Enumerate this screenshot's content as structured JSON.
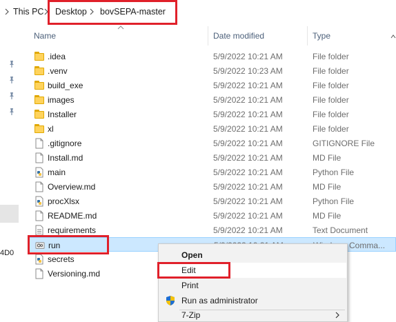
{
  "breadcrumb": {
    "items": [
      "This PC",
      "Desktop",
      "bovSEPA-master"
    ]
  },
  "leftnav": {
    "partial_label": "4D0"
  },
  "columns": {
    "name": "Name",
    "date_modified": "Date modified",
    "type": "Type"
  },
  "files": [
    {
      "name": ".idea",
      "date": "5/9/2022 10:21 AM",
      "type": "File folder",
      "icon": "folder-icon"
    },
    {
      "name": ".venv",
      "date": "5/9/2022 10:23 AM",
      "type": "File folder",
      "icon": "folder-icon"
    },
    {
      "name": "build_exe",
      "date": "5/9/2022 10:21 AM",
      "type": "File folder",
      "icon": "folder-icon"
    },
    {
      "name": "images",
      "date": "5/9/2022 10:21 AM",
      "type": "File folder",
      "icon": "folder-icon"
    },
    {
      "name": "Installer",
      "date": "5/9/2022 10:21 AM",
      "type": "File folder",
      "icon": "folder-icon"
    },
    {
      "name": "xl",
      "date": "5/9/2022 10:21 AM",
      "type": "File folder",
      "icon": "folder-icon"
    },
    {
      "name": ".gitignore",
      "date": "5/9/2022 10:21 AM",
      "type": "GITIGNORE File",
      "icon": "document-icon"
    },
    {
      "name": "Install.md",
      "date": "5/9/2022 10:21 AM",
      "type": "MD File",
      "icon": "document-icon"
    },
    {
      "name": "main",
      "date": "5/9/2022 10:21 AM",
      "type": "Python File",
      "icon": "python-file-icon"
    },
    {
      "name": "Overview.md",
      "date": "5/9/2022 10:21 AM",
      "type": "MD File",
      "icon": "document-icon"
    },
    {
      "name": "procXlsx",
      "date": "5/9/2022 10:21 AM",
      "type": "Python File",
      "icon": "python-file-icon"
    },
    {
      "name": "README.md",
      "date": "5/9/2022 10:21 AM",
      "type": "MD File",
      "icon": "document-icon"
    },
    {
      "name": "requirements",
      "date": "5/9/2022 10:21 AM",
      "type": "Text Document",
      "icon": "text-file-icon"
    },
    {
      "name": "run",
      "date": "5/9/2022 10:21 AM",
      "type": "Windows Comma...",
      "icon": "batch-file-icon",
      "selected": true
    },
    {
      "name": "secrets",
      "date": "",
      "type": "...e",
      "icon": "python-file-icon"
    },
    {
      "name": "Versioning.md",
      "date": "",
      "type": "",
      "icon": "document-icon"
    }
  ],
  "context_menu": {
    "items": [
      {
        "label": "Open",
        "bold": true
      },
      {
        "label": "Edit",
        "hover": true
      },
      {
        "label": "Print"
      },
      {
        "label": "Run as administrator",
        "icon": "uac-shield-icon"
      },
      {
        "label": "7-Zip",
        "submenu": true
      }
    ]
  },
  "colors": {
    "highlight_red": "#e0202a",
    "selection_bg": "#cce8ff",
    "folder_yellow": "#ffd35c",
    "header_text": "#4c607a"
  }
}
